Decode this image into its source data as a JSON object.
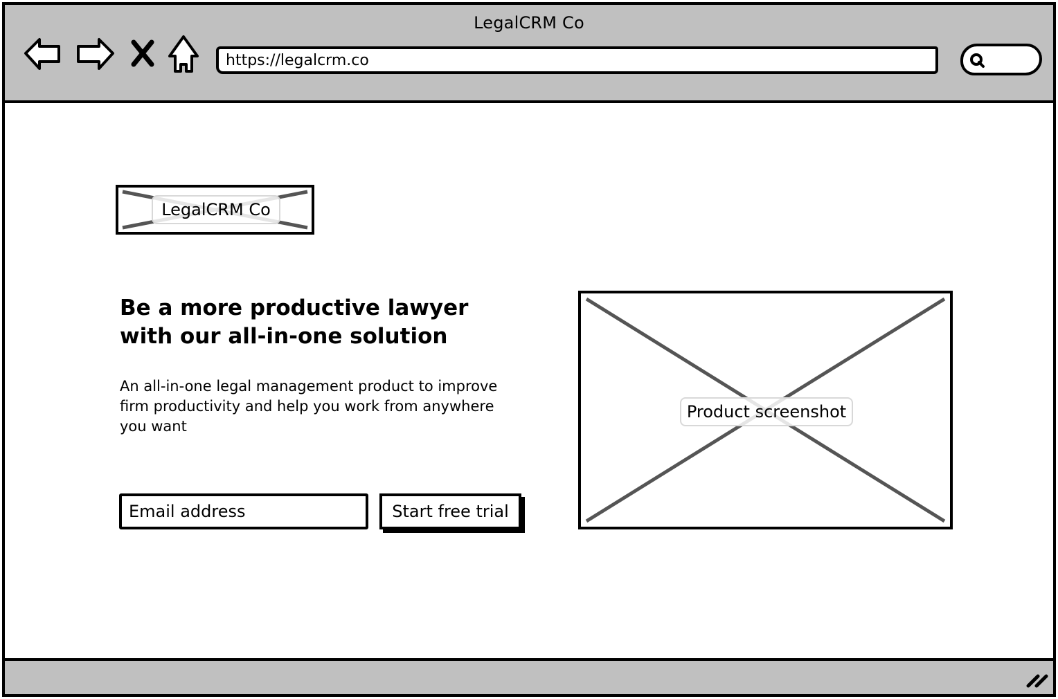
{
  "browser": {
    "title": "LegalCRM Co",
    "url": "https://legalcrm.co",
    "nav_icons": [
      "back-arrow-icon",
      "forward-arrow-icon",
      "stop-icon",
      "home-icon"
    ],
    "search_icon": "search-icon"
  },
  "page": {
    "logo_placeholder": "LegalCRM Co",
    "headline": "Be a more productive lawyer with our all-in-one solution",
    "subtext": "An all-in-one legal management product to improve firm productivity and help you work from anywhere you want",
    "email_placeholder": "Email address",
    "cta_label": "Start free trial",
    "screenshot_placeholder": "Product screenshot"
  },
  "colors": {
    "chrome": "#c0c0c0",
    "border": "#000000",
    "placeholder_cross": "#555555"
  }
}
